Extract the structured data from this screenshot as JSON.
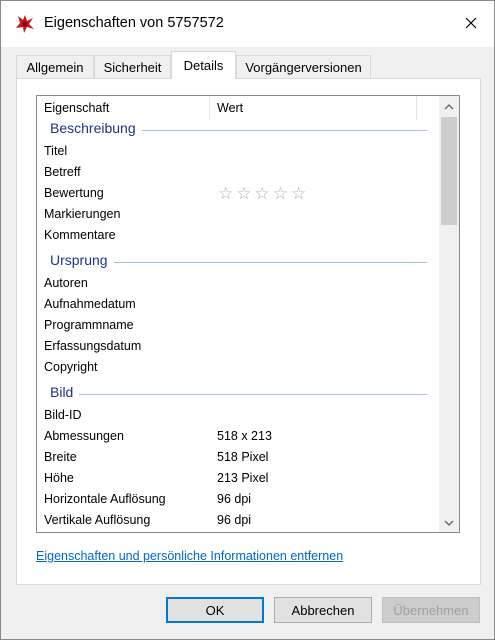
{
  "window": {
    "title": "Eigenschaften von 5757572"
  },
  "tabs": [
    {
      "label": "Allgemein"
    },
    {
      "label": "Sicherheit"
    },
    {
      "label": "Details"
    },
    {
      "label": "Vorgängerversionen"
    }
  ],
  "active_tab": "Details",
  "list": {
    "header": {
      "property": "Eigenschaft",
      "value": "Wert"
    },
    "groups": [
      {
        "label": "Beschreibung",
        "rows": [
          {
            "property": "Titel",
            "value": ""
          },
          {
            "property": "Betreff",
            "value": ""
          },
          {
            "property": "Bewertung",
            "value": "☆☆☆☆☆",
            "rating": 0
          },
          {
            "property": "Markierungen",
            "value": ""
          },
          {
            "property": "Kommentare",
            "value": ""
          }
        ]
      },
      {
        "label": "Ursprung",
        "rows": [
          {
            "property": "Autoren",
            "value": ""
          },
          {
            "property": "Aufnahmedatum",
            "value": ""
          },
          {
            "property": "Programmname",
            "value": ""
          },
          {
            "property": "Erfassungsdatum",
            "value": ""
          },
          {
            "property": "Copyright",
            "value": ""
          }
        ]
      },
      {
        "label": "Bild",
        "rows": [
          {
            "property": "Bild-ID",
            "value": ""
          },
          {
            "property": "Abmessungen",
            "value": "518 x 213"
          },
          {
            "property": "Breite",
            "value": "518 Pixel"
          },
          {
            "property": "Höhe",
            "value": "213 Pixel"
          },
          {
            "property": "Horizontale Auflösung",
            "value": "96 dpi"
          },
          {
            "property": "Vertikale Auflösung",
            "value": "96 dpi"
          }
        ]
      }
    ]
  },
  "remove_link": "Eigenschaften und persönliche Informationen entfernen",
  "buttons": {
    "ok": "OK",
    "cancel": "Abbrechen",
    "apply": "Übernehmen"
  },
  "colors": {
    "accent": "#0078d7",
    "group_label": "#1e3287",
    "link": "#0066cc"
  },
  "icons": {
    "title": "properties-app-icon",
    "close": "close-icon"
  }
}
